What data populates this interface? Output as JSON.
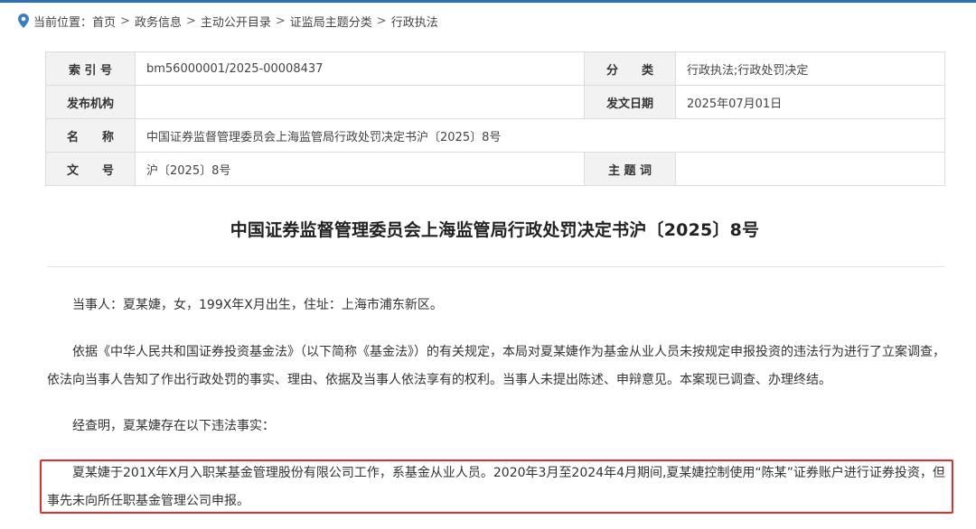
{
  "breadcrumb": {
    "prefix": "当前位置：",
    "items": [
      "首页",
      "政务信息",
      "主动公开目录",
      "证监局主题分类",
      "行政执法"
    ]
  },
  "meta": {
    "index_label": "索 引 号",
    "index_value": "bm56000001/2025-00008437",
    "category_label": "分　　类",
    "category_value": "行政执法;行政处罚决定",
    "publisher_label": "发布机构",
    "publisher_value": "",
    "date_label": "发文日期",
    "date_value": "2025年07月01日",
    "name_label": "名　　称",
    "name_value": "中国证券监督管理委员会上海监管局行政处罚决定书沪〔2025〕8号",
    "docno_label": "文　　号",
    "docno_value": "沪〔2025〕8号",
    "subject_label": "主 题 词",
    "subject_value": ""
  },
  "document": {
    "title": "中国证券监督管理委员会上海监管局行政处罚决定书沪〔2025〕8号",
    "paragraphs": [
      "当事人：夏某婕，女，199X年X月出生，住址：上海市浦东新区。",
      "依据《中华人民共和国证券投资基金法》（以下简称《基金法》）的有关规定，本局对夏某婕作为基金从业人员未按规定申报投资的违法行为进行了立案调查，依法向当事人告知了作出行政处罚的事实、理由、依据及当事人依法享有的权利。当事人未提出陈述、申辩意见。本案现已调查、办理终结。",
      "经查明，夏某婕存在以下违法事实：",
      "夏某婕于201X年X月入职某基金管理股份有限公司工作，系基金从业人员。2020年3月至2024年4月期间,夏某婕控制使用“陈某”证券账户进行证券投资，但事先未向所任职基金管理公司申报。"
    ]
  },
  "colors": {
    "highlight_border": "#e0302a",
    "accent": "#2f6fb5",
    "label_bg": "#f2f2f2"
  }
}
